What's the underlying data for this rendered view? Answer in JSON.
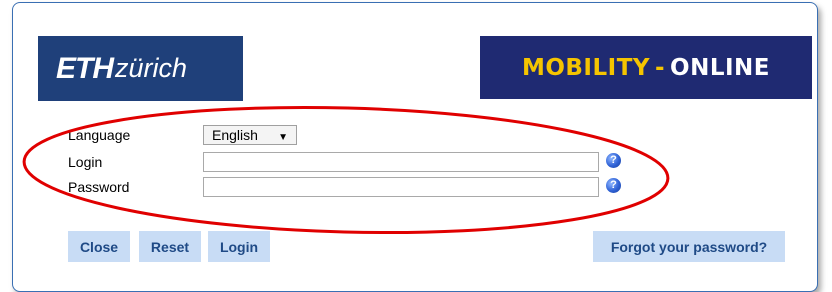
{
  "logos": {
    "eth_bold": "ETH",
    "eth_rest": "zürich",
    "mobility_part1": "MOBILITY",
    "mobility_sep": "-",
    "mobility_part2": "ONLINE"
  },
  "form": {
    "language_label": "Language",
    "language_value": "English",
    "login_label": "Login",
    "login_value": "",
    "password_label": "Password",
    "password_value": ""
  },
  "buttons": {
    "close": "Close",
    "reset": "Reset",
    "login": "Login",
    "forgot": "Forgot your password?"
  },
  "icons": {
    "help": "help-icon",
    "dropdown": "chevron-down-icon"
  },
  "colors": {
    "eth_blue": "#1f407a",
    "mobility_navy": "#1f2a72",
    "mobility_yellow": "#f5c400",
    "button_bg": "#c8dcf5",
    "button_text": "#1f4a86",
    "annotation_red": "#e00000"
  }
}
